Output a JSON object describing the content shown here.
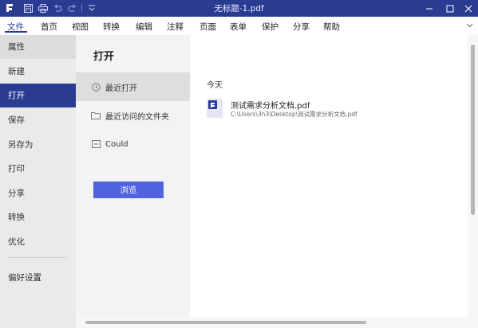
{
  "window": {
    "title": "无标题-1.pdf"
  },
  "menubar": {
    "items": [
      "文件",
      "首页",
      "视图",
      "转换",
      "编辑",
      "注释",
      "页面",
      "表单",
      "保护",
      "分享",
      "帮助"
    ]
  },
  "sidebar": {
    "items": [
      "属性",
      "新建",
      "打开",
      "保存",
      "另存为",
      "打印",
      "分享",
      "转换",
      "优化",
      "偏好设置"
    ]
  },
  "panel": {
    "heading": "打开",
    "options": [
      "最近打开",
      "最近访问的文件夹",
      "Could"
    ],
    "browse_label": "浏览"
  },
  "recent": {
    "group_label": "今天",
    "files": [
      {
        "name": "测试需求分析文档.pdf",
        "path": "C:\\Users\\3h3\\Desktop\\测试需求分析文档.pdf"
      }
    ]
  },
  "colors": {
    "accent": "#2a3c92",
    "button": "#4f62e0"
  }
}
